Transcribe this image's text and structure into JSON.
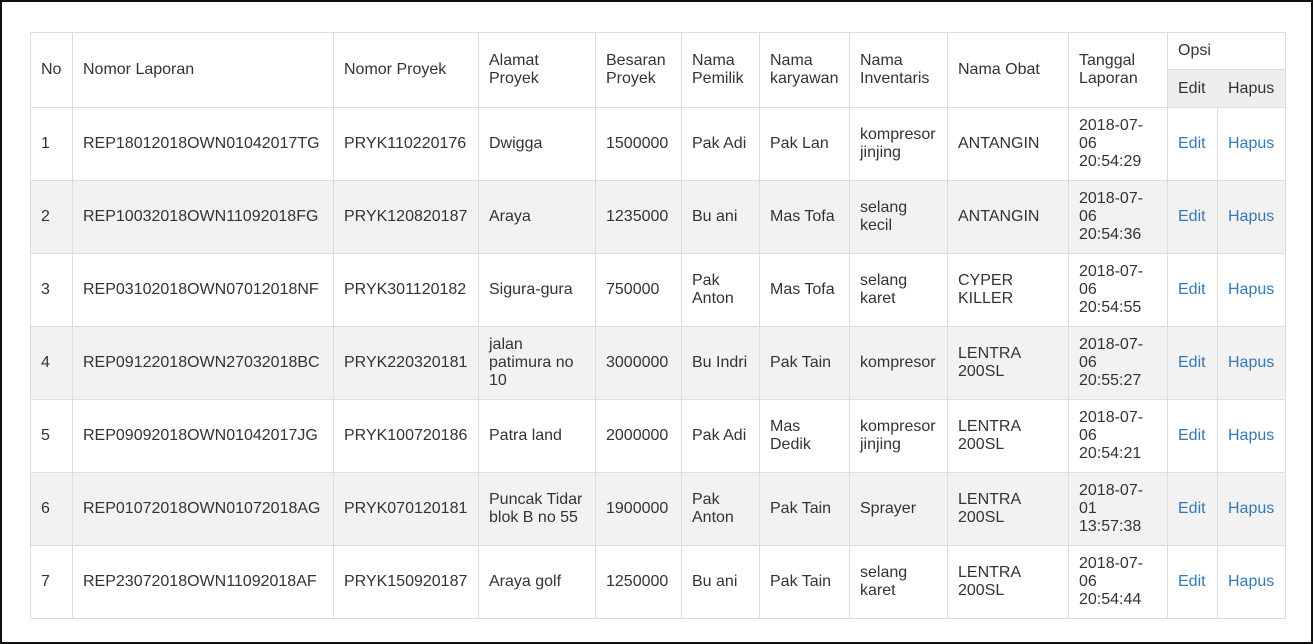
{
  "table": {
    "headers": {
      "no": "No",
      "nomor_laporan": "Nomor Laporan",
      "nomor_proyek": "Nomor Proyek",
      "alamat_proyek": "Alamat Proyek",
      "besaran_proyek": "Besaran Proyek",
      "nama_pemilik": "Nama Pemilik",
      "nama_karyawan": "Nama karyawan",
      "nama_inventaris": "Nama Inventaris",
      "nama_obat": "Nama Obat",
      "tanggal_laporan": "Tanggal Laporan",
      "opsi": "Opsi",
      "edit": "Edit",
      "hapus": "Hapus"
    },
    "rows": [
      {
        "no": "1",
        "nomor_laporan": "REP18012018OWN01042017TG",
        "nomor_proyek": "PRYK110220176",
        "alamat": "Dwigga",
        "besaran": "1500000",
        "pemilik": "Pak Adi",
        "karyawan": "Pak Lan",
        "inventaris": "kompresor jinjing",
        "obat": "ANTANGIN",
        "tanggal": "2018-07-06 20:54:29",
        "edit": "Edit",
        "hapus": "Hapus"
      },
      {
        "no": "2",
        "nomor_laporan": "REP10032018OWN11092018FG",
        "nomor_proyek": "PRYK120820187",
        "alamat": "Araya",
        "besaran": "1235000",
        "pemilik": "Bu ani",
        "karyawan": "Mas Tofa",
        "inventaris": "selang kecil",
        "obat": "ANTANGIN",
        "tanggal": "2018-07-06 20:54:36",
        "edit": "Edit",
        "hapus": "Hapus"
      },
      {
        "no": "3",
        "nomor_laporan": "REP03102018OWN07012018NF",
        "nomor_proyek": "PRYK301120182",
        "alamat": "Sigura-gura",
        "besaran": "750000",
        "pemilik": "Pak Anton",
        "karyawan": "Mas Tofa",
        "inventaris": "selang karet",
        "obat": "CYPER KILLER",
        "tanggal": "2018-07-06 20:54:55",
        "edit": "Edit",
        "hapus": "Hapus"
      },
      {
        "no": "4",
        "nomor_laporan": "REP09122018OWN27032018BC",
        "nomor_proyek": "PRYK220320181",
        "alamat": "jalan patimura no 10",
        "besaran": "3000000",
        "pemilik": "Bu Indri",
        "karyawan": "Pak Tain",
        "inventaris": "kompresor",
        "obat": "LENTRA 200SL",
        "tanggal": "2018-07-06 20:55:27",
        "edit": "Edit",
        "hapus": "Hapus"
      },
      {
        "no": "5",
        "nomor_laporan": "REP09092018OWN01042017JG",
        "nomor_proyek": "PRYK100720186",
        "alamat": "Patra land",
        "besaran": "2000000",
        "pemilik": "Pak Adi",
        "karyawan": "Mas Dedik",
        "inventaris": "kompresor jinjing",
        "obat": "LENTRA 200SL",
        "tanggal": "2018-07-06 20:54:21",
        "edit": "Edit",
        "hapus": "Hapus"
      },
      {
        "no": "6",
        "nomor_laporan": "REP01072018OWN01072018AG",
        "nomor_proyek": "PRYK070120181",
        "alamat": "Puncak Tidar blok B no 55",
        "besaran": "1900000",
        "pemilik": "Pak Anton",
        "karyawan": "Pak Tain",
        "inventaris": "Sprayer",
        "obat": "LENTRA 200SL",
        "tanggal": "2018-07-01 13:57:38",
        "edit": "Edit",
        "hapus": "Hapus"
      },
      {
        "no": "7",
        "nomor_laporan": "REP23072018OWN11092018AF",
        "nomor_proyek": "PRYK150920187",
        "alamat": "Araya golf",
        "besaran": "1250000",
        "pemilik": "Bu ani",
        "karyawan": "Pak Tain",
        "inventaris": "selang karet",
        "obat": "LENTRA 200SL",
        "tanggal": "2018-07-06 20:54:44",
        "edit": "Edit",
        "hapus": "Hapus"
      }
    ]
  },
  "colors": {
    "link": "#337ab7",
    "stripe": "#f2f2f2",
    "border": "#dddddd",
    "subheader_bg": "#eeeeee"
  }
}
